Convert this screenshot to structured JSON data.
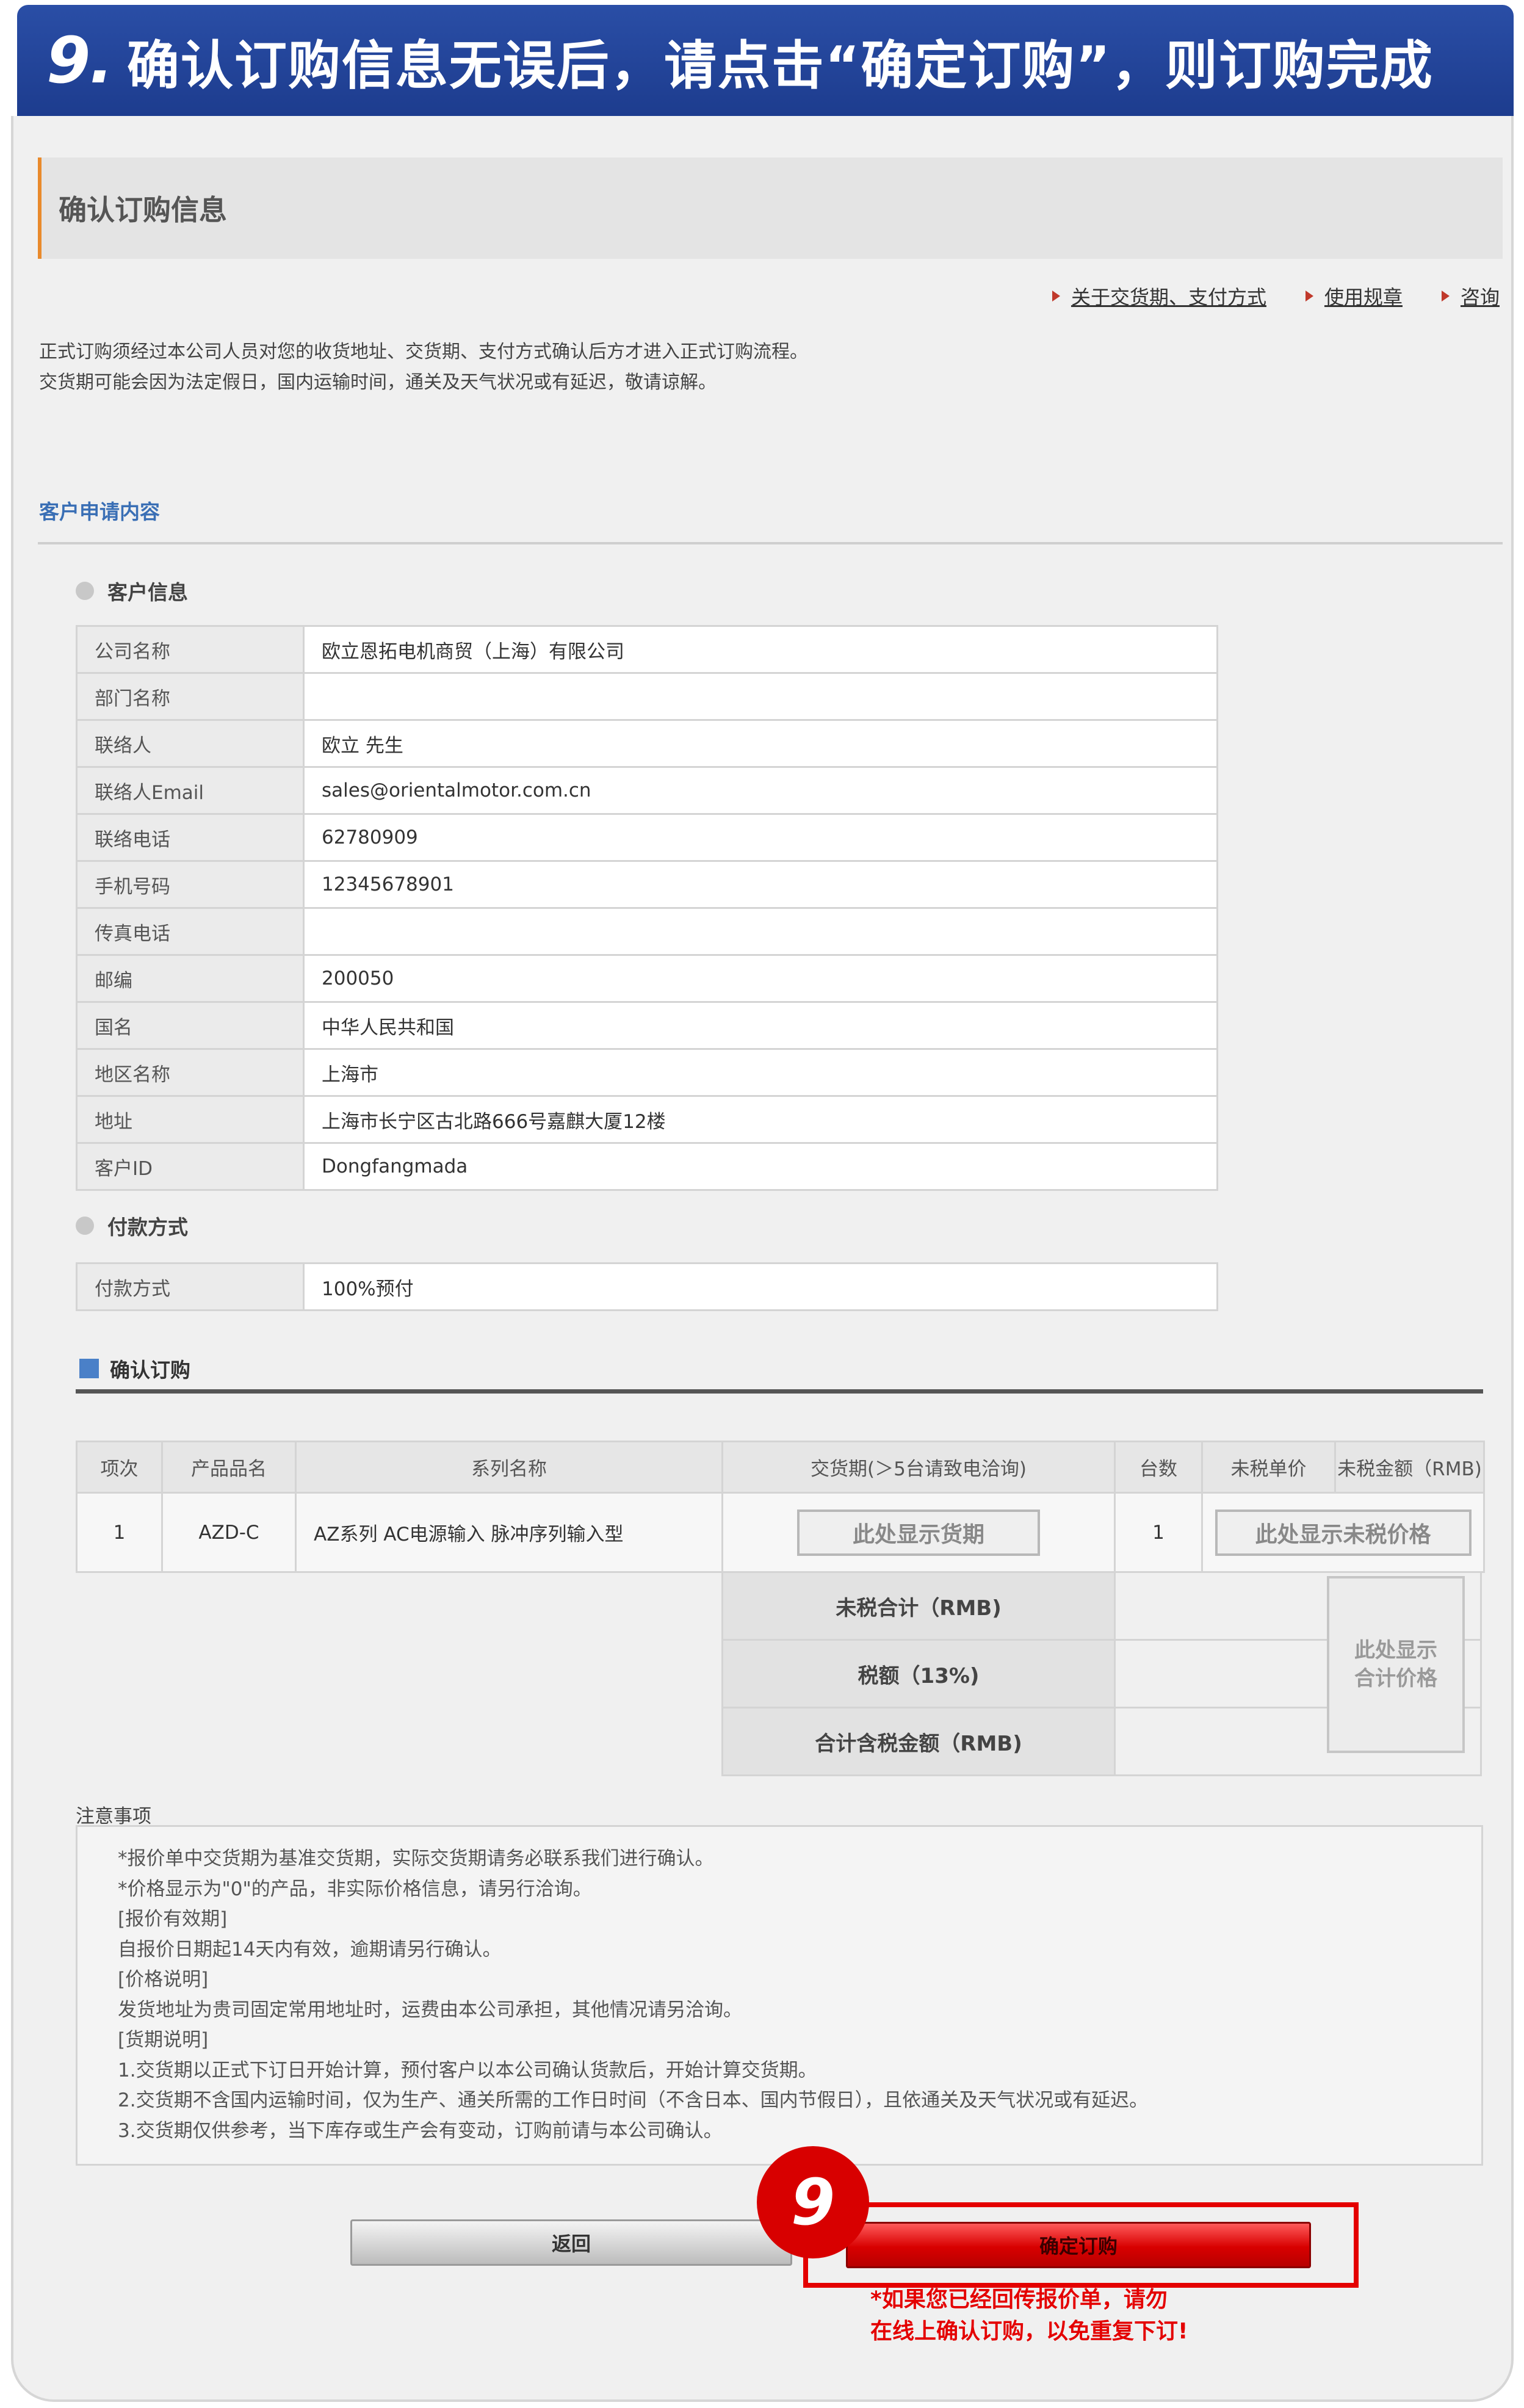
{
  "banner": {
    "step": "9.",
    "text": "确认订购信息无误后，请点击“确定订购”，则订购完成"
  },
  "page": {
    "title": "确认订购信息",
    "links": [
      "关于交货期、支付方式",
      "使用规章",
      "咨询"
    ],
    "intro": [
      "正式订购须经过本公司人员对您的收货地址、交货期、支付方式确认后方才进入正式订购流程。",
      "交货期可能会因为法定假日，国内运输时间，通关及天气状况或有延迟，敬请谅解。"
    ],
    "section_title": "客户申请内容"
  },
  "customer": {
    "heading": "客户信息",
    "rows": [
      {
        "label": "公司名称",
        "value": "欧立恩拓电机商贸（上海）有限公司"
      },
      {
        "label": "部门名称",
        "value": ""
      },
      {
        "label": "联络人",
        "value": "欧立 先生"
      },
      {
        "label": "联络人Email",
        "value": "sales@orientalmotor.com.cn"
      },
      {
        "label": "联络电话",
        "value": "62780909"
      },
      {
        "label": "手机号码",
        "value": "12345678901"
      },
      {
        "label": "传真电话",
        "value": ""
      },
      {
        "label": "邮编",
        "value": "200050"
      },
      {
        "label": "国名",
        "value": "中华人民共和国"
      },
      {
        "label": "地区名称",
        "value": "上海市"
      },
      {
        "label": "地址",
        "value": "上海市长宁区古北路666号嘉麒大厦12楼"
      },
      {
        "label": "客户ID",
        "value": "Dongfangmada"
      }
    ]
  },
  "payment": {
    "heading": "付款方式",
    "label": "付款方式",
    "value": "100%预付"
  },
  "order": {
    "heading": "确认订购",
    "headers": [
      "项次",
      "产品品名",
      "系列名称",
      "交货期(＞5台请致电洽询)",
      "台数",
      "未税单价",
      "未税金额（RMB)"
    ],
    "row": {
      "index": "1",
      "product": "AZD-C",
      "series": "AZ系列 AC电源输入 脉冲序列输入型",
      "delivery_placeholder": "此处显示货期",
      "qty": "1",
      "price_placeholder": "此处显示未税价格"
    },
    "summary": [
      "未税合计（RMB)",
      "税额（13%)",
      "合计含税金额（RMB)"
    ],
    "total_placeholder_1": "此处显示",
    "total_placeholder_2": "合计价格"
  },
  "notes": {
    "label": "注意事项",
    "lines": [
      "*报价单中交货期为基准交货期，实际交货期请务必联系我们进行确认。",
      "*价格显示为\"0\"的产品，非实际价格信息，请另行洽询。",
      "[报价有效期]",
      "自报价日期起14天内有效，逾期请另行确认。",
      "[价格说明]",
      "发货地址为贵司固定常用地址时，运费由本公司承担，其他情况请另洽询。",
      "[货期说明]",
      "1.交货期以正式下订日开始计算，预付客户以本公司确认货款后，开始计算交货期。",
      "2.交货期不含国内运输时间，仅为生产、通关所需的工作日时间（不含日本、国内节假日），且依通关及天气状况或有延迟。",
      "3.交货期仅供参考，当下库存或生产会有变动，订购前请与本公司确认。"
    ]
  },
  "buttons": {
    "back": "返回",
    "confirm": "确定订购"
  },
  "callout": {
    "badge": "9",
    "tip_1": "*如果您已经回传报价单，请勿",
    "tip_2": "在线上确认订购，以免重复下订!"
  },
  "colors": {
    "banner": "#1d3c8e",
    "accent_orange": "#e98a2c",
    "section_blue": "#3a6fb5",
    "highlight_red": "#e40000"
  }
}
